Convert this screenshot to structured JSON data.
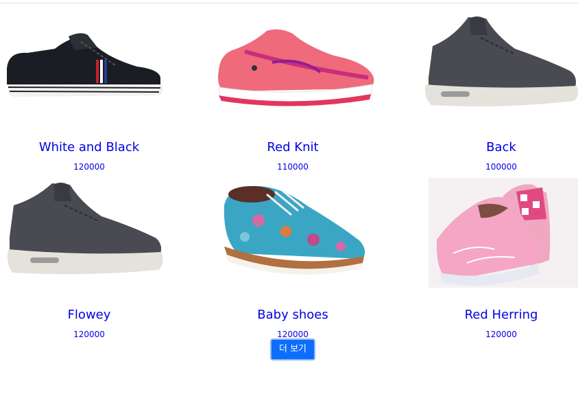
{
  "colors": {
    "link": "#0000e6",
    "button_bg": "#0d6efd",
    "button_border": "#8db7f7"
  },
  "products": [
    {
      "name": "White and Black",
      "price": "120000",
      "image_icon": "black-sneaker-image"
    },
    {
      "name": "Red Knit",
      "price": "110000",
      "image_icon": "red-running-shoe-image"
    },
    {
      "name": "Back",
      "price": "100000",
      "image_icon": "grey-high-top-image"
    },
    {
      "name": "Flowey",
      "price": "120000",
      "image_icon": "grey-high-top-image"
    },
    {
      "name": "Baby shoes",
      "price": "120000",
      "image_icon": "floral-oxford-image"
    },
    {
      "name": "Red Herring",
      "price": "120000",
      "image_icon": "pink-slip-on-image"
    }
  ],
  "load_more_label": "더 보기"
}
